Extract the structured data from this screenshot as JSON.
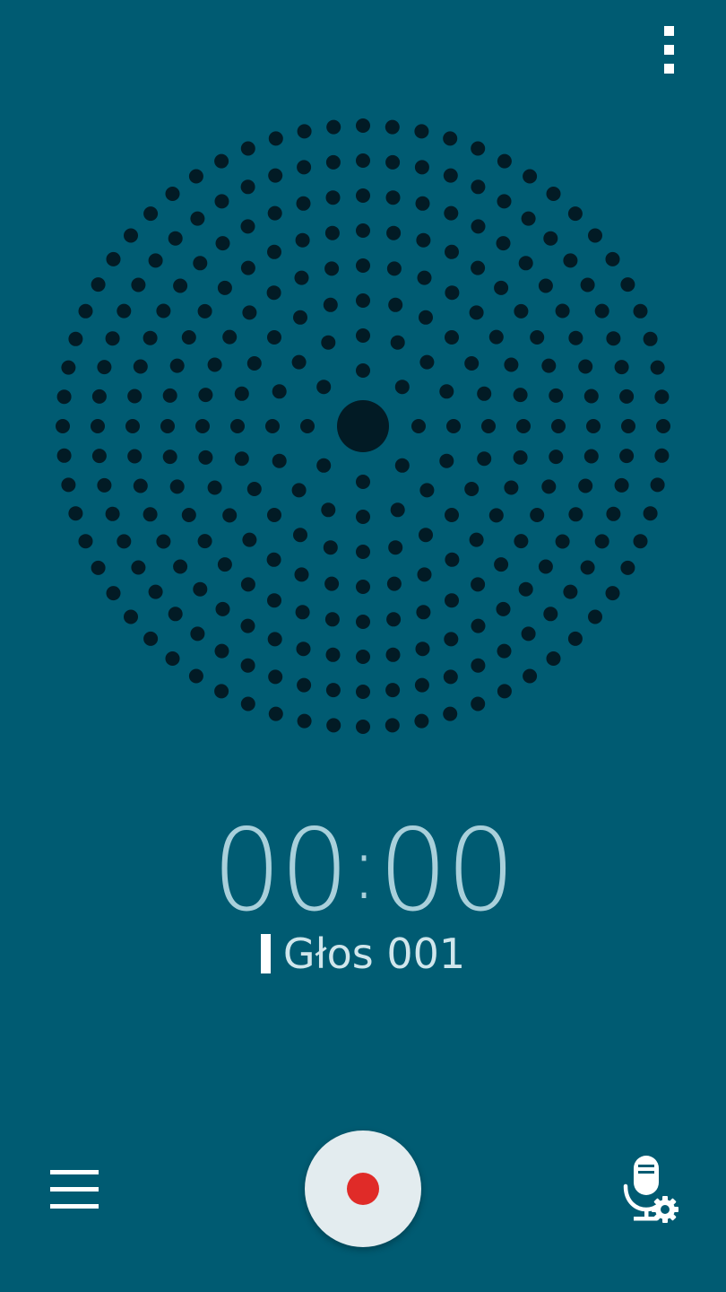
{
  "colors": {
    "background": "#005b72",
    "visualizer_dot": "#021b25",
    "timer_text": "#a9d0db",
    "file_name_text": "#d0e6ec",
    "record_button_fill": "#e3ecef",
    "record_dot": "#e02b28",
    "icon": "#ffffff"
  },
  "timer": {
    "minutes": "00",
    "separator": ":",
    "seconds": "00"
  },
  "recording": {
    "file_name": "Głos 001"
  },
  "icons": {
    "overflow_menu": "more-vertical-icon",
    "list": "hamburger-list-icon",
    "record": "record-icon",
    "settings": "microphone-settings-icon"
  }
}
